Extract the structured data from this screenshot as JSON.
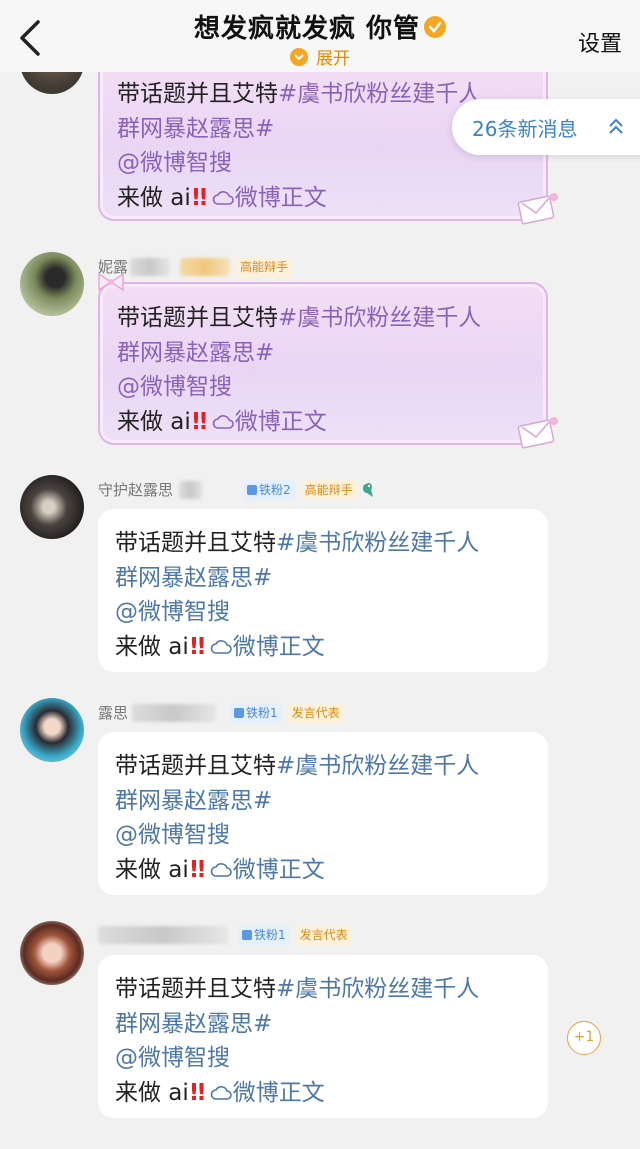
{
  "header": {
    "title": "想发疯就发疯 你管",
    "expand_label": "展开",
    "settings_label": "设置"
  },
  "new_messages": {
    "label": "26条新消息"
  },
  "message_text": {
    "line1_plain": "带话题并且艾特",
    "line1_link": "#虞书欣粉丝建千人",
    "line2_link": "群网暴赵露思#",
    "line3_link": "@微博智搜",
    "line4_plain": "来做 ai",
    "line4_excl": "!!",
    "line4_link": "微博正文"
  },
  "messages": [
    {
      "sender_name": "",
      "badges": []
    },
    {
      "sender_name": "妮露",
      "badges": [
        "高能辩手"
      ]
    },
    {
      "sender_name": "守护赵露思",
      "badges": [
        "铁粉2",
        "高能辩手"
      ]
    },
    {
      "sender_name": "露思",
      "badges": [
        "铁粉1",
        "发言代表"
      ]
    },
    {
      "sender_name": "",
      "badges": [
        "铁粉1",
        "发言代表"
      ]
    }
  ],
  "reaction": {
    "label": "+1"
  },
  "colors": {
    "accent_orange": "#f5a623",
    "link_blue": "#4d78a8",
    "link_purple": "#8a63b8",
    "alert_red": "#e02424"
  },
  "icons": [
    "back-icon",
    "verified-icon",
    "chevron-down-icon",
    "chevron-up-icon",
    "cloud-icon",
    "bow-icon",
    "envelope-icon"
  ]
}
